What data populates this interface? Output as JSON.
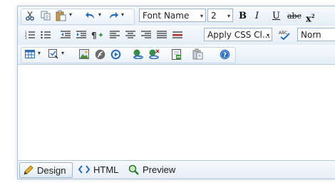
{
  "toolbar": {
    "font_name": "Font Name",
    "font_size": "2",
    "css_class": "Apply CSS Cl...",
    "paragraph_style": "Norn",
    "bold": "B",
    "italic": "I",
    "underline": "U",
    "strike": "abc",
    "superscript": "x",
    "dropdown_arrow": "▾"
  },
  "modes": {
    "design": "Design",
    "html": "HTML",
    "preview": "Preview"
  },
  "colors": {
    "toolbar_top": "#f7fafd",
    "toolbar_bottom": "#e4edf6",
    "border": "#a8bfd6",
    "accent": "#2b6cb8"
  }
}
